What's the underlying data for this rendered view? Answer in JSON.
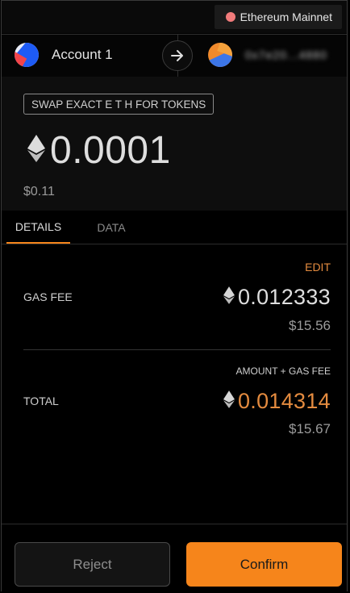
{
  "network": {
    "label": "Ethereum Mainnet",
    "status_color": "#f17b7b"
  },
  "accounts": {
    "from_name": "Account 1",
    "to_address": "0x7e20...4880",
    "arrow_icon": "arrow-right-icon"
  },
  "summary": {
    "method": "SWAP EXACT E T H FOR TOKENS",
    "amount": "0.0001",
    "fiat": "$0.11",
    "currency_icon": "eth-icon"
  },
  "tabs": [
    {
      "label": "DETAILS",
      "active": true
    },
    {
      "label": "DATA",
      "active": false
    }
  ],
  "details": {
    "edit_label": "EDIT",
    "gas_fee_label": "GAS FEE",
    "gas_fee_eth": "0.012333",
    "gas_fee_fiat": "$15.56",
    "amount_gas_label": "AMOUNT + GAS FEE",
    "total_label": "TOTAL",
    "total_eth": "0.014314",
    "total_fiat": "$15.67"
  },
  "footer": {
    "reject_label": "Reject",
    "confirm_label": "Confirm"
  },
  "colors": {
    "accent": "#f6851b",
    "total_amount": "#e48b3f",
    "background": "#000000"
  }
}
